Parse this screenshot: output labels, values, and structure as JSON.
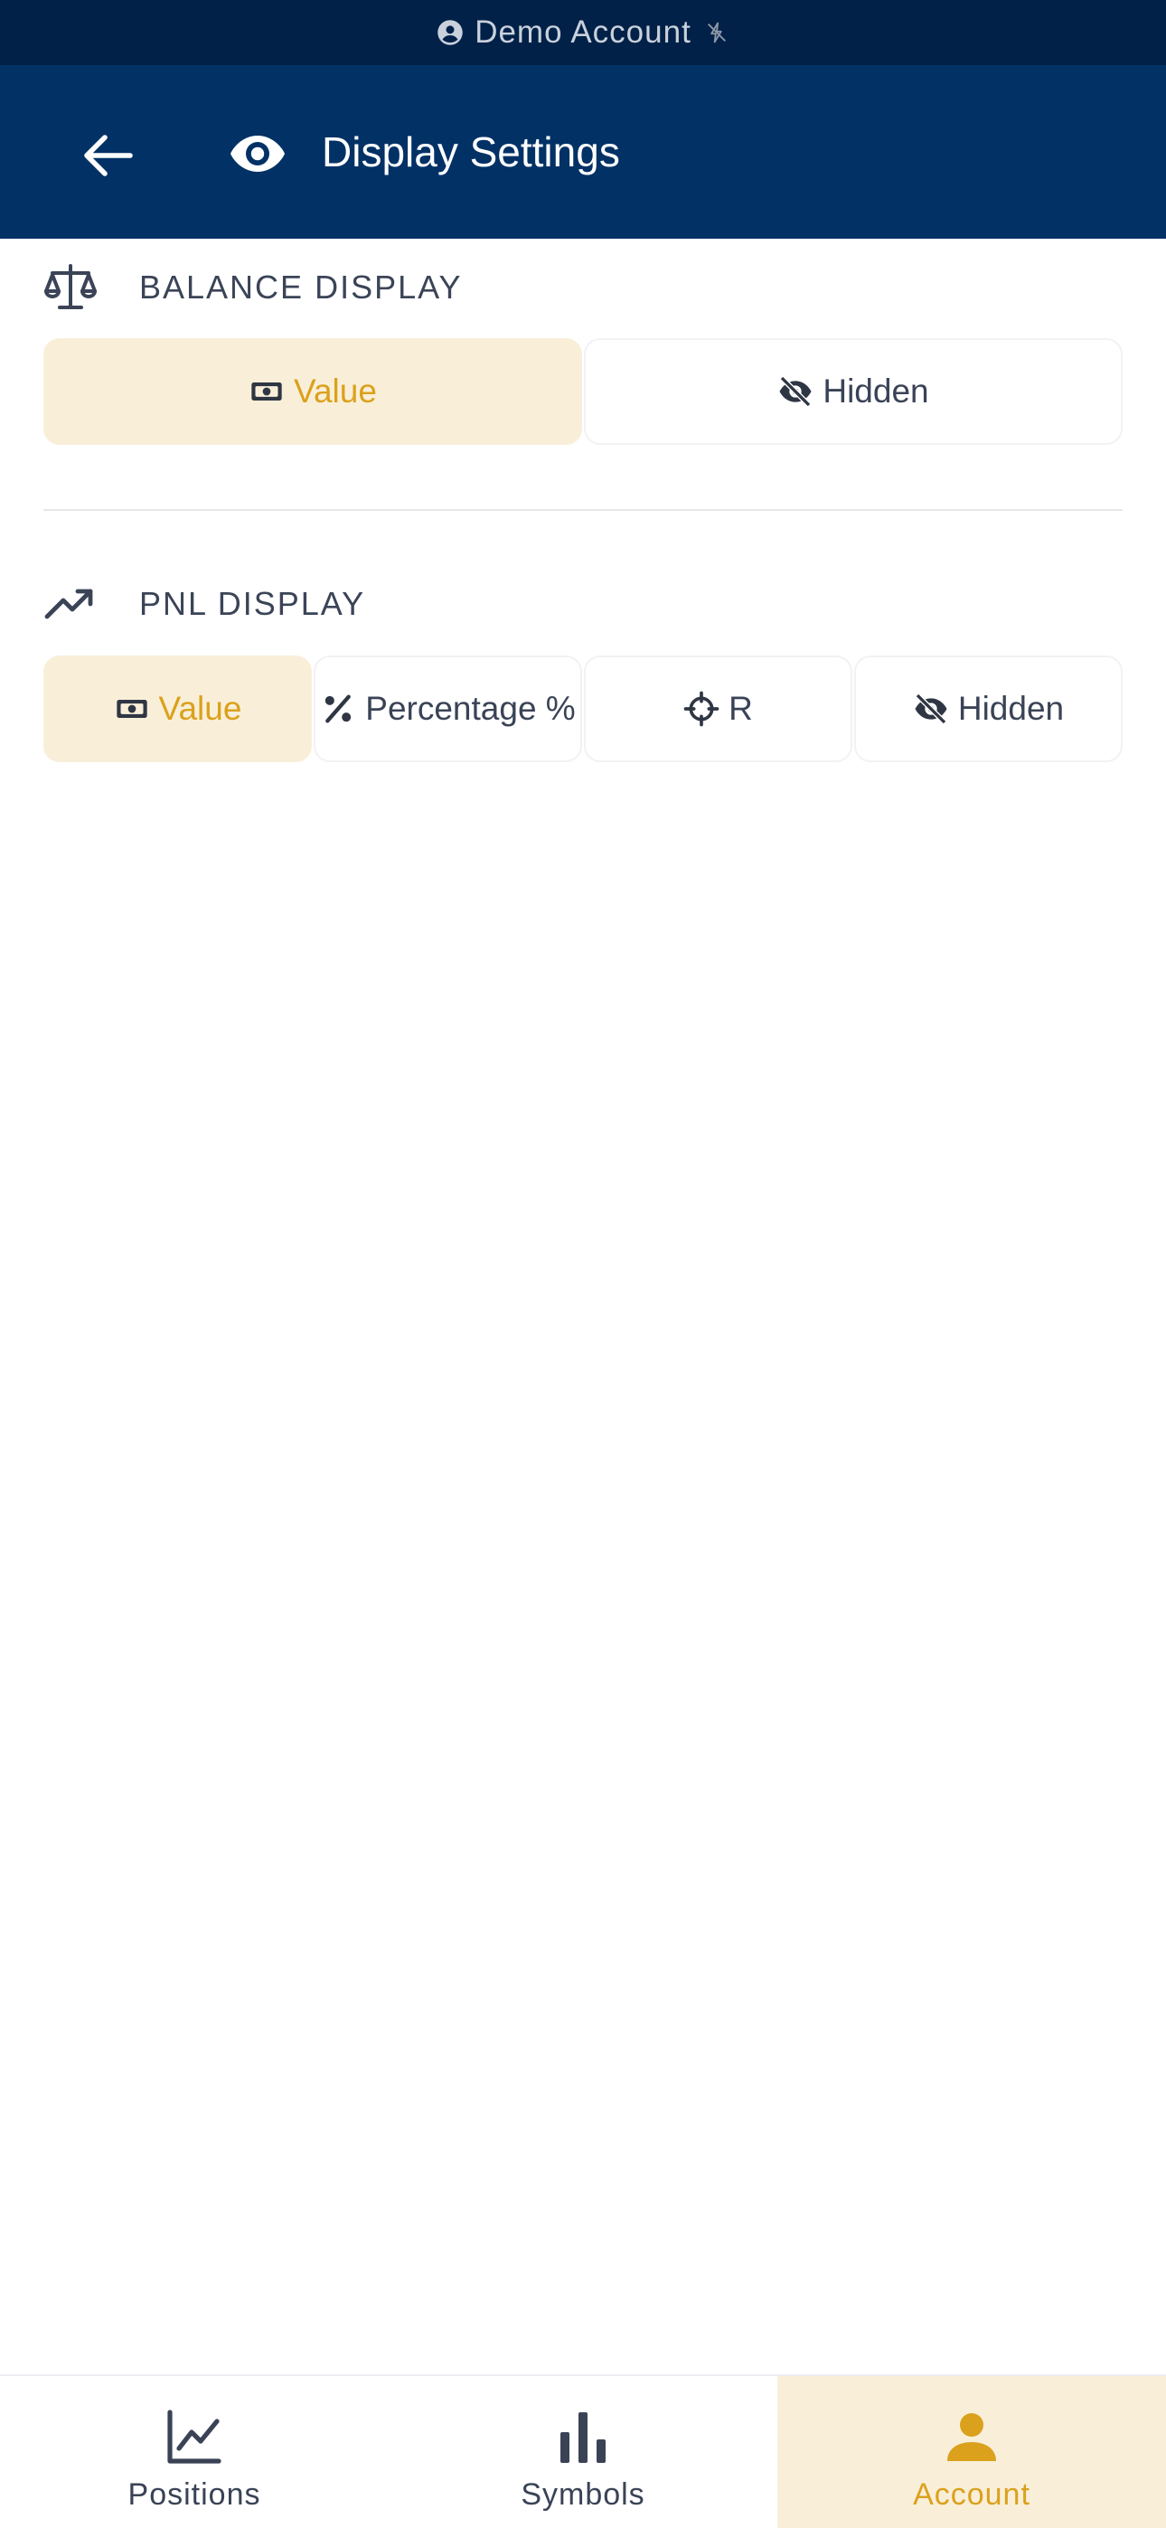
{
  "status_bar": {
    "text": "Demo Account"
  },
  "header": {
    "title": "Display Settings"
  },
  "balance": {
    "label": "BALANCE DISPLAY",
    "options": [
      {
        "label": "Value",
        "icon": "cash-icon",
        "selected": true
      },
      {
        "label": "Hidden",
        "icon": "eye-off-icon",
        "selected": false
      }
    ]
  },
  "pnl": {
    "label": "PNL DISPLAY",
    "options": [
      {
        "label": "Value",
        "icon": "cash-icon",
        "selected": true
      },
      {
        "label": "Percentage %",
        "icon": "percent-icon",
        "selected": false
      },
      {
        "label": "R",
        "icon": "crosshair-icon",
        "selected": false
      },
      {
        "label": "Hidden",
        "icon": "eye-off-icon",
        "selected": false
      }
    ]
  },
  "nav": {
    "items": [
      {
        "label": "Positions",
        "icon": "line-chart-icon",
        "active": false
      },
      {
        "label": "Symbols",
        "icon": "bar-chart-icon",
        "active": false
      },
      {
        "label": "Account",
        "icon": "person-icon",
        "active": true
      }
    ]
  },
  "colors": {
    "header_bg": "#013165",
    "status_bg": "#012148",
    "accent": "#dba11c",
    "accent_bg": "#f9efd9",
    "text": "#3a4356"
  }
}
